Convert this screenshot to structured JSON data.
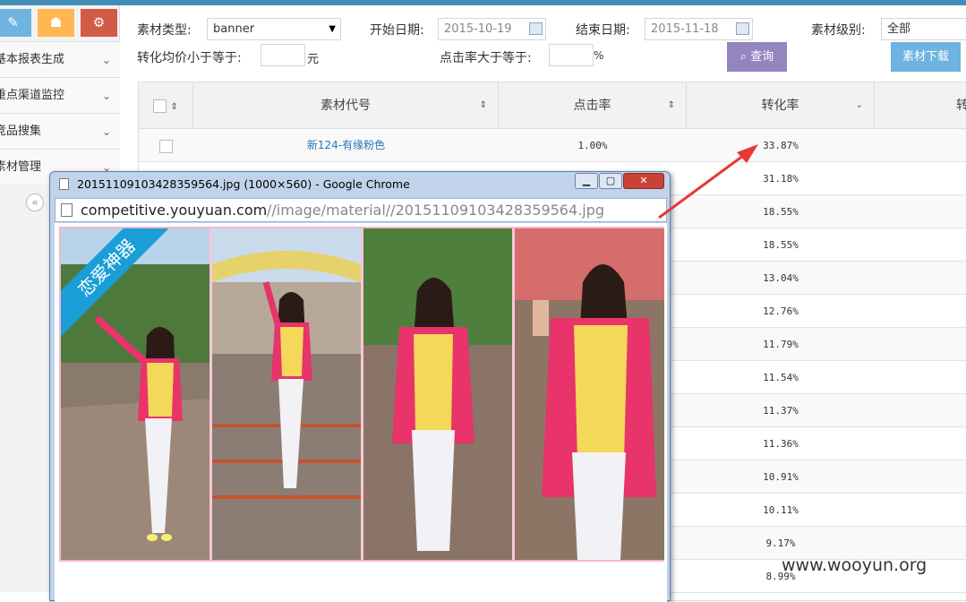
{
  "sidebar": {
    "items": [
      {
        "label": "基本报表生成"
      },
      {
        "label": "重点渠道监控"
      },
      {
        "label": "竞品搜集"
      },
      {
        "label": "素材管理"
      }
    ],
    "collapse_glyph": "«"
  },
  "filters": {
    "material_type_label": "素材类型:",
    "material_type_value": "banner",
    "start_date_label": "开始日期:",
    "start_date_value": "2015-10-19",
    "end_date_label": "结束日期:",
    "end_date_value": "2015-11-18",
    "material_level_label": "素材级别:",
    "material_level_value": "全部",
    "conv_price_label": "转化均价小于等于:",
    "conv_price_unit": "元",
    "ctr_label": "点击率大于等于:",
    "ctr_unit": "%",
    "query_label": "查询",
    "download_label": "素材下载"
  },
  "table": {
    "headers": [
      "素材代号",
      "点击率",
      "转化率",
      "转"
    ],
    "rows": [
      {
        "name": "新124-有缘粉色",
        "ctr": "1.00%",
        "conv": "33.87%"
      },
      {
        "conv": "31.18%"
      },
      {
        "conv": "18.55%"
      },
      {
        "conv": "18.55%"
      },
      {
        "conv": "13.04%"
      },
      {
        "conv": "12.76%"
      },
      {
        "conv": "11.79%"
      },
      {
        "conv": "11.54%"
      },
      {
        "conv": "11.37%"
      },
      {
        "conv": "11.36%"
      },
      {
        "conv": "10.91%"
      },
      {
        "conv": "10.11%"
      },
      {
        "conv": "9.17%"
      },
      {
        "conv": "8.99%"
      }
    ]
  },
  "popup": {
    "title": "20151109103428359564.jpg (1000×560) - Google Chrome",
    "url_host": "competitive.youyuan.com",
    "url_path": "//image/material//20151109103428359564.jpg",
    "ribbon_text": "恋爱神器"
  },
  "watermark": "www.wooyun.org",
  "colors": {
    "brand_blue": "#438eb9",
    "query_button": "#9585bf",
    "download_button": "#6fb3e0",
    "ribbon": "#1a9ed8",
    "annotation_arrow": "#e53935"
  }
}
